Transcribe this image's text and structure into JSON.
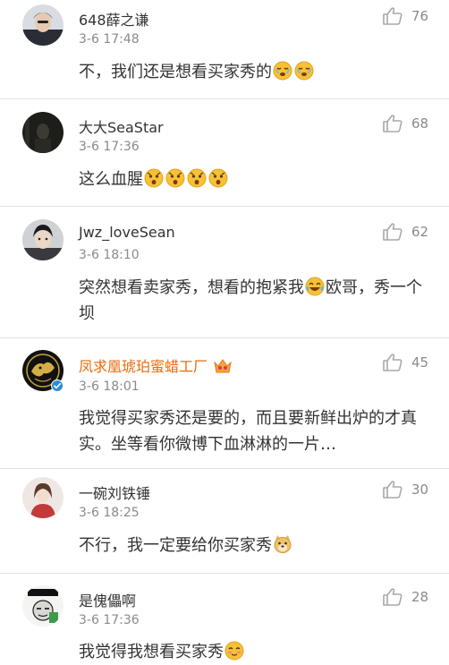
{
  "comments": [
    {
      "username": "648薛之谦",
      "time": "3-6 17:48",
      "text": "不，我们还是想看买家秀的",
      "likes": "76",
      "emojis": [
        "pleading-face",
        "pleading-face"
      ]
    },
    {
      "username": "大大SeaStar",
      "time": "3-6 17:36",
      "text": "这么血腥",
      "likes": "68",
      "emojis": [
        "scared-face",
        "scared-face",
        "scared-face",
        "scared-face"
      ]
    },
    {
      "username": "Jwz_loveSean",
      "time": "3-6 18:10",
      "text_before": "突然想看卖家秀，想看的抱紧我",
      "text_after": "欧哥，秀一个坝",
      "likes": "62",
      "emojis": [
        "tears-of-joy"
      ]
    },
    {
      "username": "凤求凰琥珀蜜蜡工厂",
      "time": "3-6 18:01",
      "text": "我觉得买家秀还是要的，而且要新鲜出炉的才真实。坐等看你微博下血淋淋的一片…",
      "likes": "45",
      "badges": [
        "vip-crown-icon",
        "verified-icon"
      ]
    },
    {
      "username": "一碗刘铁锤",
      "time": "3-6 18:25",
      "text": "不行，我一定要给你买家秀",
      "likes": "30",
      "emojis": [
        "doge-face"
      ]
    },
    {
      "username": "是傀儡啊",
      "time": "3-6 17:36",
      "text": "我觉得我想看买家秀",
      "likes": "28",
      "emojis": [
        "shy-face"
      ]
    }
  ],
  "colors": {
    "username": "#333333",
    "vip_username": "#e86b0c",
    "meta": "#8a8a8a",
    "divider": "#e2e2e2",
    "emoji_fill": "#f7c136"
  }
}
